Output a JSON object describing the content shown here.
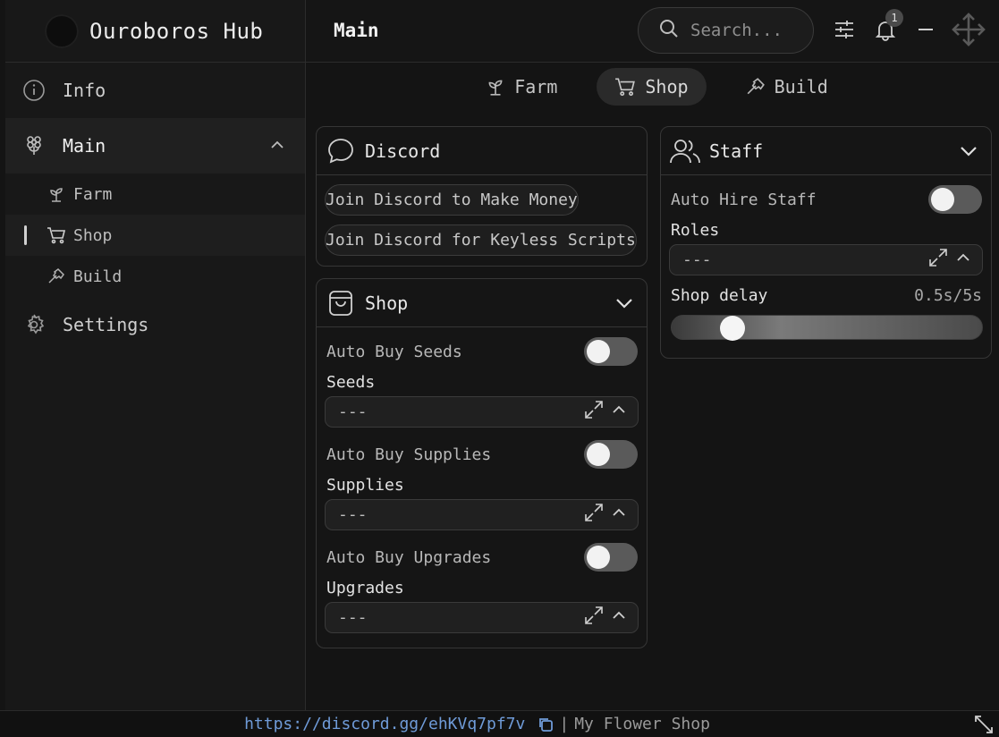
{
  "app": {
    "title": "Ouroboros Hub"
  },
  "header": {
    "page_title": "Main",
    "search_placeholder": "Search...",
    "notification_count": "1"
  },
  "sidebar": {
    "items": [
      {
        "label": "Info",
        "icon": "info-icon"
      },
      {
        "label": "Main",
        "icon": "flower-icon"
      },
      {
        "label": "Settings",
        "icon": "gear-icon"
      }
    ],
    "subitems": [
      {
        "label": "Farm",
        "icon": "sprout-icon"
      },
      {
        "label": "Shop",
        "icon": "cart-icon"
      },
      {
        "label": "Build",
        "icon": "hammer-icon"
      }
    ]
  },
  "tabs": [
    {
      "label": "Farm",
      "icon": "sprout-icon"
    },
    {
      "label": "Shop",
      "icon": "cart-icon"
    },
    {
      "label": "Build",
      "icon": "hammer-icon"
    }
  ],
  "discord_panel": {
    "title": "Discord",
    "buttons": [
      "Join Discord to Make Money",
      "Join Discord for Keyless Scripts"
    ]
  },
  "shop_panel": {
    "title": "Shop",
    "toggles": [
      {
        "label": "Auto Buy Seeds",
        "dropdown_label": "Seeds",
        "dropdown_value": "---"
      },
      {
        "label": "Auto Buy Supplies",
        "dropdown_label": "Supplies",
        "dropdown_value": "---"
      },
      {
        "label": "Auto Buy Upgrades",
        "dropdown_label": "Upgrades",
        "dropdown_value": "---"
      }
    ]
  },
  "staff_panel": {
    "title": "Staff",
    "toggle_label": "Auto Hire Staff",
    "roles_label": "Roles",
    "roles_value": "---",
    "slider_label": "Shop delay",
    "slider_value": "0.5s/5s",
    "slider_fraction": 0.1
  },
  "footer": {
    "link": "https://discord.gg/ehKVq7pf7v",
    "shop_name": "My Flower Shop"
  }
}
